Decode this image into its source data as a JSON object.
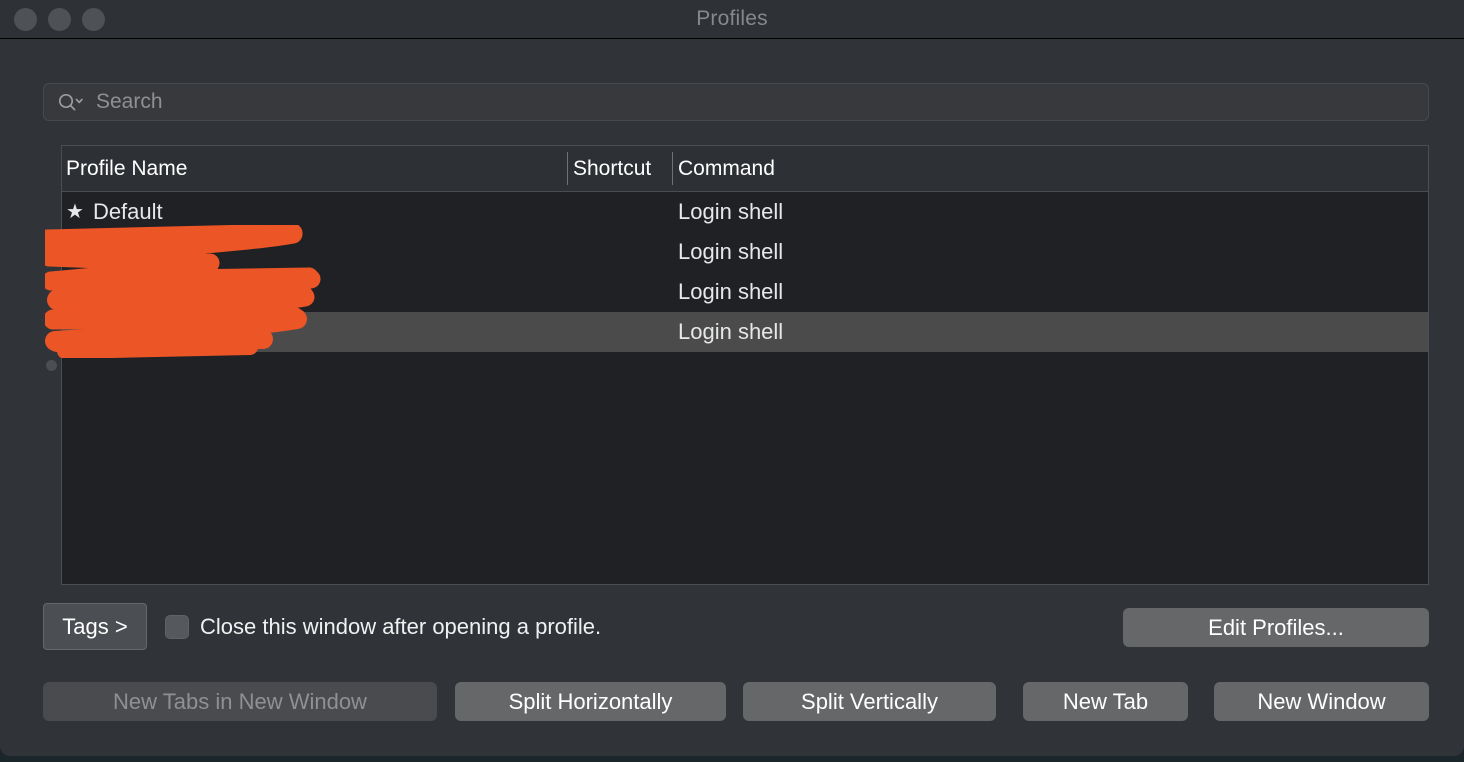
{
  "window": {
    "title": "Profiles",
    "traffic_lights": [
      "close",
      "minimize",
      "zoom"
    ]
  },
  "search": {
    "placeholder": "Search",
    "value": "",
    "icon": "search-magnifier-chevron-icon"
  },
  "table": {
    "columns": [
      {
        "key": "profile_name",
        "label": "Profile Name"
      },
      {
        "key": "shortcut",
        "label": "Shortcut"
      },
      {
        "key": "command",
        "label": "Command"
      }
    ],
    "rows": [
      {
        "profile_name": "Default",
        "is_default": true,
        "star": "★",
        "shortcut": "",
        "command": "Login shell",
        "selected": false,
        "redacted": false
      },
      {
        "profile_name": "",
        "is_default": false,
        "star": "",
        "shortcut": "",
        "command": "Login shell",
        "selected": false,
        "redacted": true
      },
      {
        "profile_name": "",
        "is_default": false,
        "star": "",
        "shortcut": "",
        "command": "Login shell",
        "selected": false,
        "redacted": true
      },
      {
        "profile_name": "",
        "is_default": false,
        "star": "",
        "shortcut": "",
        "command": "Login shell",
        "selected": true,
        "redacted": true
      }
    ]
  },
  "redaction": {
    "color": "#EC5526",
    "note": "hand-drawn scribble obscuring profile names"
  },
  "controls": {
    "tags_label": "Tags >",
    "close_window_checkbox": {
      "label": "Close this window after opening a profile.",
      "checked": false
    },
    "edit_profiles_label": "Edit Profiles..."
  },
  "bottom_buttons": [
    {
      "id": "new-tabs-in-new-window",
      "label": "New Tabs in New Window",
      "enabled": false
    },
    {
      "id": "split-horizontally",
      "label": "Split Horizontally",
      "enabled": true
    },
    {
      "id": "split-vertically",
      "label": "Split Vertically",
      "enabled": true
    },
    {
      "id": "new-tab",
      "label": "New Tab",
      "enabled": true
    },
    {
      "id": "new-window",
      "label": "New Window",
      "enabled": true
    }
  ],
  "colors": {
    "window_background": "#303337",
    "titlebar": "#2E3135",
    "table_header": "#2D3034",
    "table_body": "#1F2125",
    "selected_row": "#4B4B4B",
    "button": "#656769",
    "button_disabled": "#494B4E",
    "text_primary": "#E6E7E8",
    "text_muted": "#8E9093",
    "redaction": "#EC5526"
  }
}
